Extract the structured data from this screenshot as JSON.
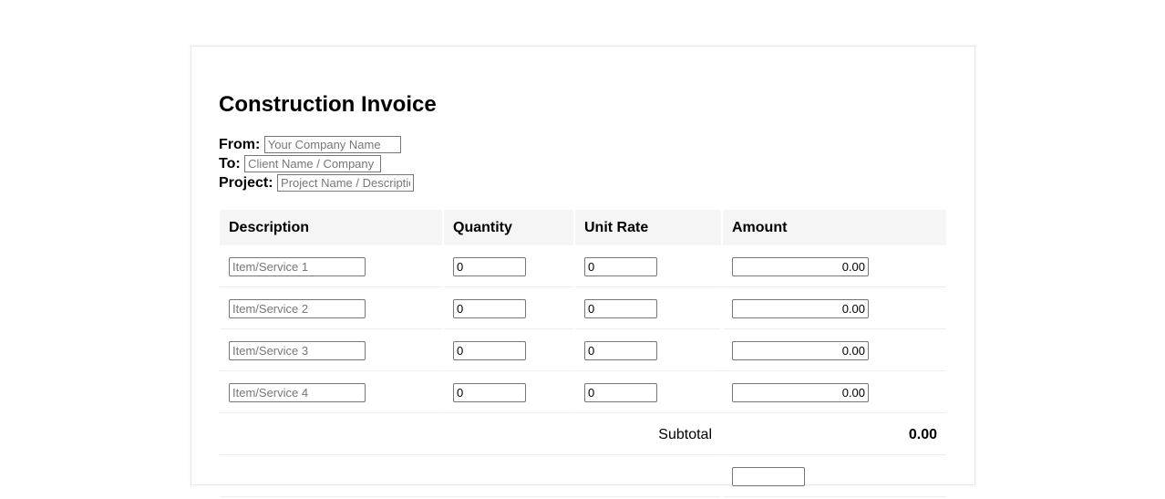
{
  "title": "Construction Invoice",
  "meta": [
    {
      "label": "From:",
      "placeholder": "Your Company Name",
      "value": ""
    },
    {
      "label": "To:",
      "placeholder": "Client Name / Company",
      "value": ""
    },
    {
      "label": "Project:",
      "placeholder": "Project Name / Description",
      "value": ""
    }
  ],
  "table": {
    "headers": [
      "Description",
      "Quantity",
      "Unit Rate",
      "Amount"
    ],
    "rows": [
      {
        "placeholder": "Item/Service 1",
        "quantity": "0",
        "rate": "0",
        "amount": "0.00"
      },
      {
        "placeholder": "Item/Service 2",
        "quantity": "0",
        "rate": "0",
        "amount": "0.00"
      },
      {
        "placeholder": "Item/Service 3",
        "quantity": "0",
        "rate": "0",
        "amount": "0.00"
      },
      {
        "placeholder": "Item/Service 4",
        "quantity": "0",
        "rate": "0",
        "amount": "0.00"
      }
    ],
    "subtotal_label": "Subtotal",
    "subtotal_value": "0.00"
  }
}
